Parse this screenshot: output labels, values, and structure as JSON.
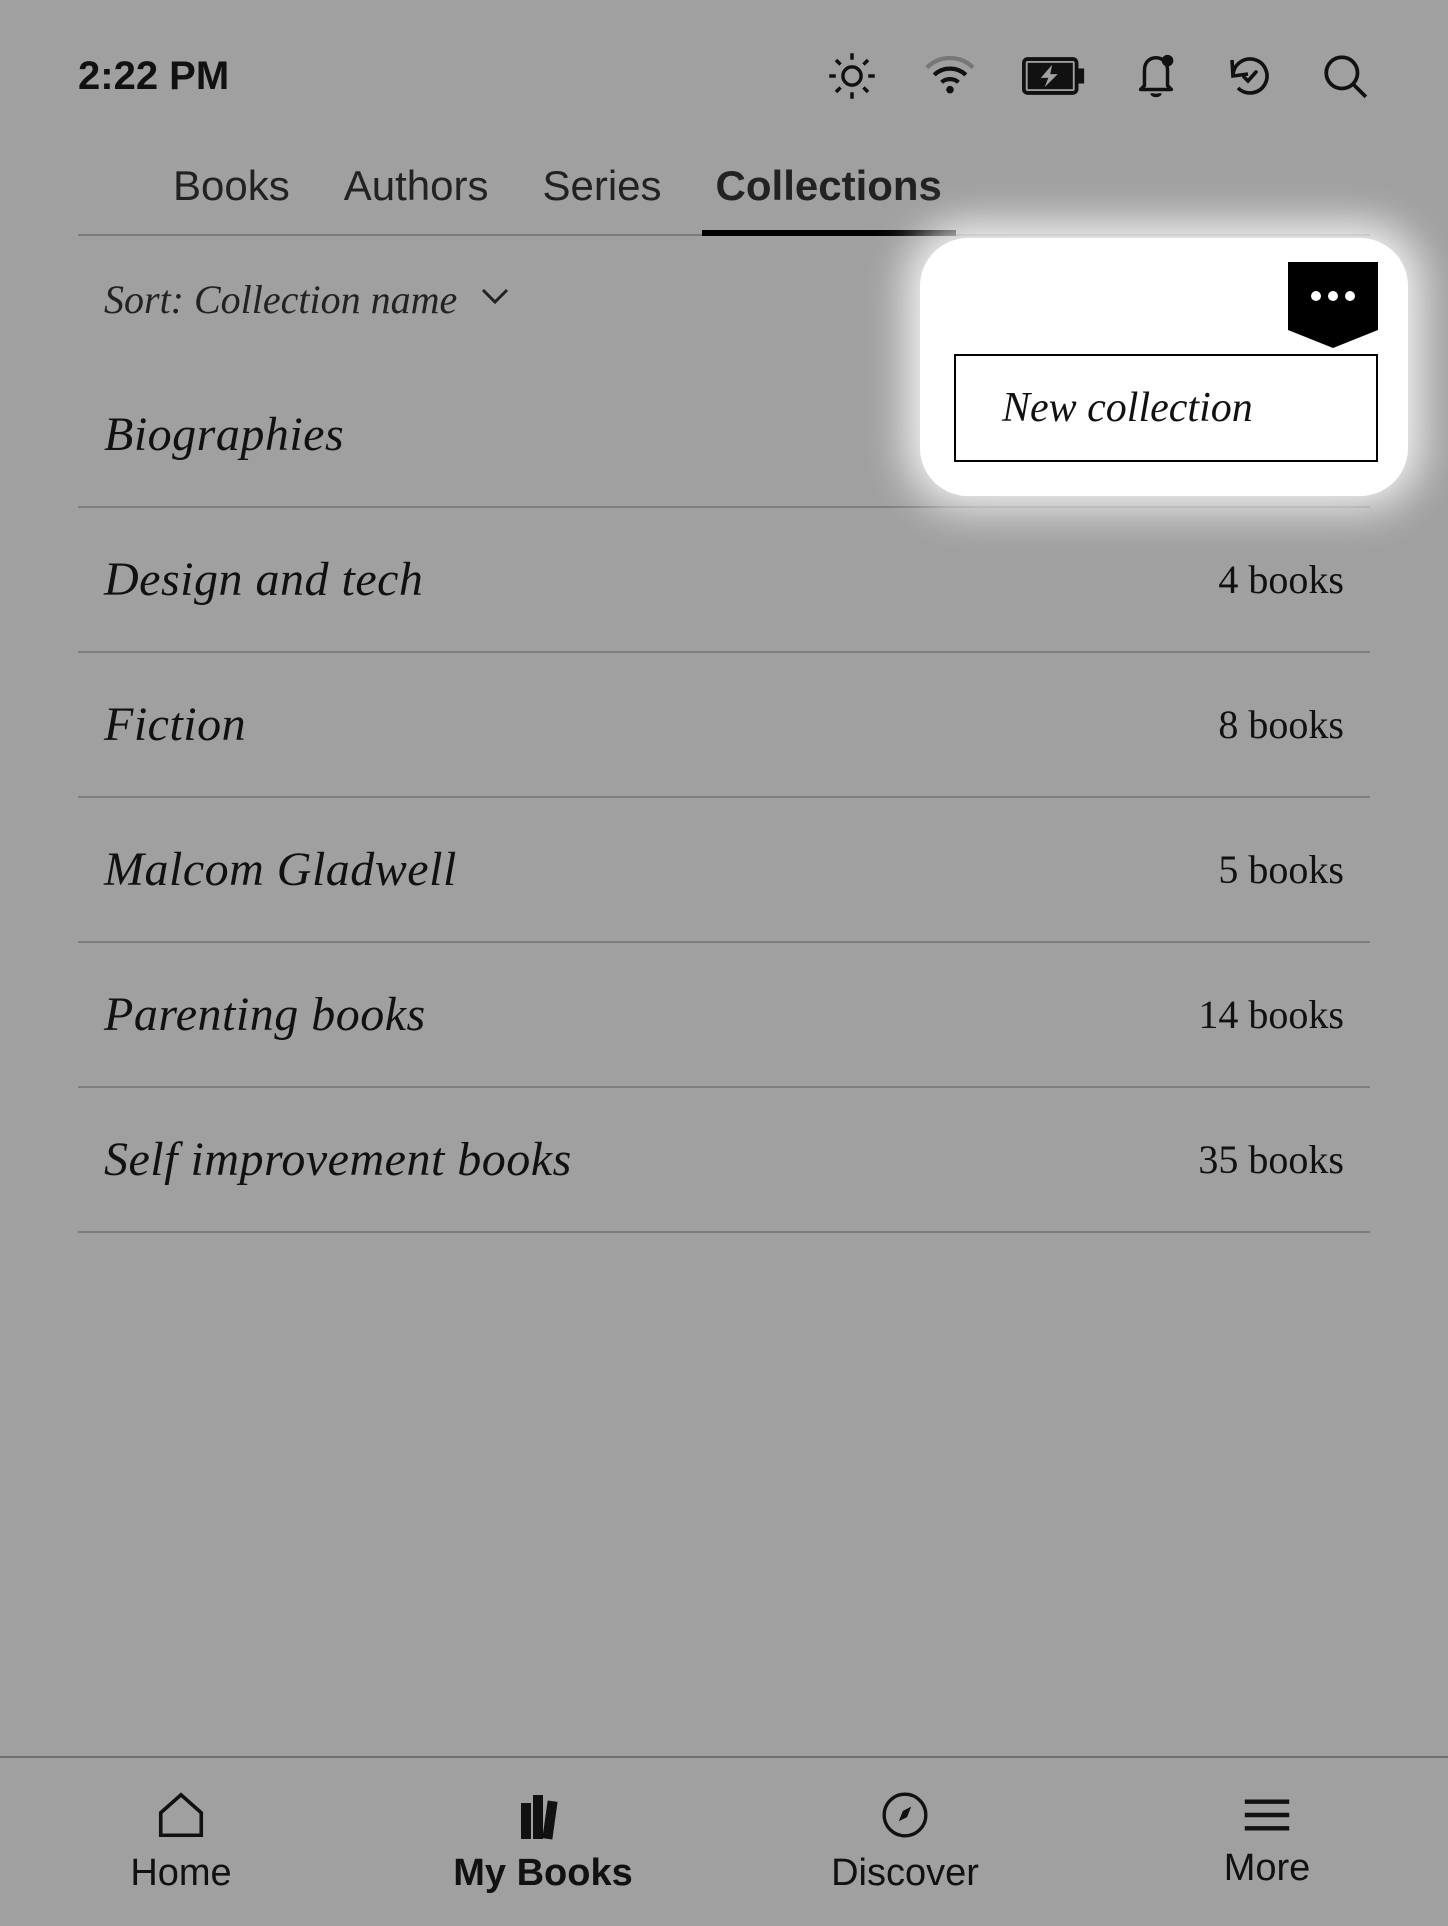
{
  "status": {
    "time": "2:22 PM"
  },
  "tabs": [
    {
      "label": "Books",
      "active": false
    },
    {
      "label": "Authors",
      "active": false
    },
    {
      "label": "Series",
      "active": false
    },
    {
      "label": "Collections",
      "active": true
    }
  ],
  "sort": {
    "label": "Sort: Collection name"
  },
  "collections": [
    {
      "name": "Biographies",
      "count": ""
    },
    {
      "name": "Design and tech",
      "count": "4 books"
    },
    {
      "name": "Fiction",
      "count": "8 books"
    },
    {
      "name": "Malcom Gladwell",
      "count": "5 books"
    },
    {
      "name": "Parenting books",
      "count": "14 books"
    },
    {
      "name": "Self improvement books",
      "count": "35 books"
    }
  ],
  "popover": {
    "new_collection_label": "New collection"
  },
  "nav": [
    {
      "label": "Home",
      "active": false
    },
    {
      "label": "My Books",
      "active": true
    },
    {
      "label": "Discover",
      "active": false
    },
    {
      "label": "More",
      "active": false
    }
  ]
}
